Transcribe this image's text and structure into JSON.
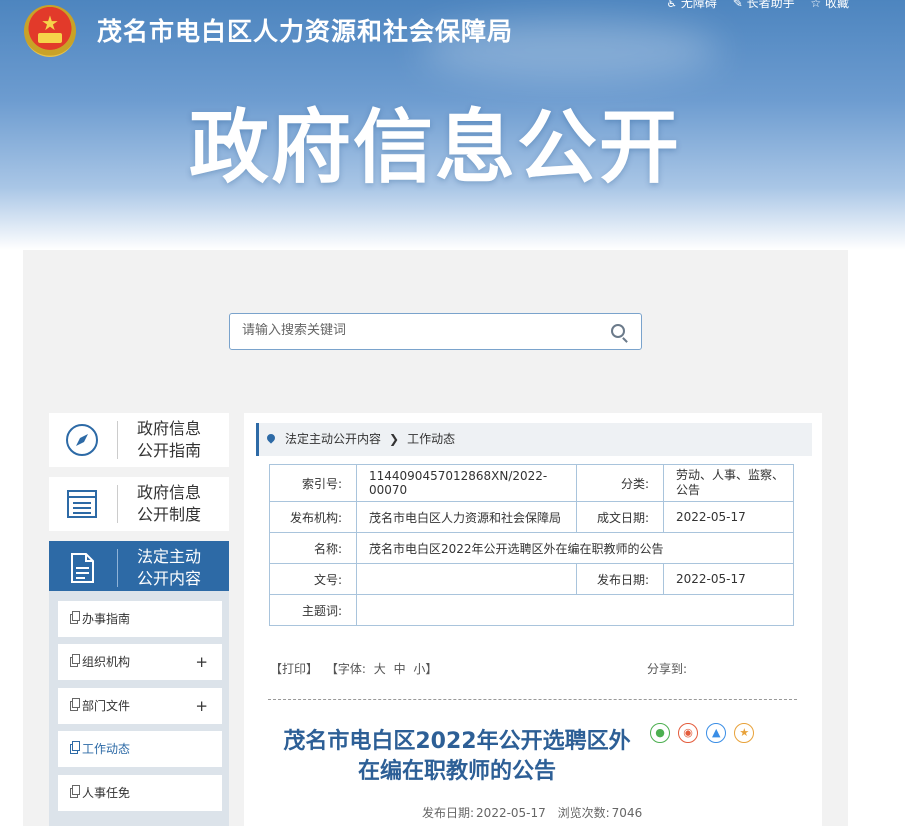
{
  "header": {
    "site_title": "茂名市电白区人力资源和社会保障局",
    "top_links": [
      "无障碍",
      "长者助手",
      "收藏"
    ],
    "hero_title": "政府信息公开"
  },
  "search": {
    "placeholder": "请输入搜索关键词"
  },
  "sidebar": {
    "nav": [
      {
        "line1": "政府信息",
        "line2": "公开指南",
        "icon": "compass-icon"
      },
      {
        "line1": "政府信息",
        "line2": "公开制度",
        "icon": "document-list-icon"
      },
      {
        "line1": "法定主动",
        "line2": "公开内容",
        "icon": "file-icon",
        "active": true
      }
    ],
    "subitems": [
      {
        "label": "办事指南",
        "expandable": false
      },
      {
        "label": "组织机构",
        "expandable": true
      },
      {
        "label": "部门文件",
        "expandable": true
      },
      {
        "label": "工作动态",
        "expandable": false,
        "active": true
      },
      {
        "label": "人事任免",
        "expandable": false
      }
    ],
    "expand_symbol": "+"
  },
  "breadcrumb": {
    "parent": "法定主动公开内容",
    "separator": "❯",
    "current": "工作动态"
  },
  "info": {
    "index_label": "索引号:",
    "index_value": "1144090457012868XN/2022-00070",
    "category_label": "分类:",
    "category_value": "劳动、人事、监察、公告",
    "issuer_label": "发布机构:",
    "issuer_value": "茂名市电白区人力资源和社会保障局",
    "created_label": "成文日期:",
    "created_value": "2022-05-17",
    "name_label": "名称:",
    "name_value": "茂名市电白区2022年公开选聘区外在编在职教师的公告",
    "docno_label": "文号:",
    "docno_value": "",
    "published_label": "发布日期:",
    "published_value": "2022-05-17",
    "keywords_label": "主题词:",
    "keywords_value": ""
  },
  "tools": {
    "print": "【打印】",
    "font_label": "【字体:",
    "font_large": "大",
    "font_medium": "中",
    "font_small": "小】",
    "share": "分享到:"
  },
  "article": {
    "title_line1": "茂名市电白区2022年公开选聘区外",
    "title_line2": "在编在职教师的公告",
    "publish_label": "发布日期:",
    "publish_date": "2022-05-17",
    "views_label": "浏览次数:",
    "views": "7046"
  },
  "share_icons": [
    "wechat-icon",
    "weibo-icon",
    "qq-icon",
    "favorite-icon"
  ],
  "colors": {
    "primary": "#2d6aa6",
    "title_blue": "#2d5f96",
    "border": "#a9c4dc"
  }
}
